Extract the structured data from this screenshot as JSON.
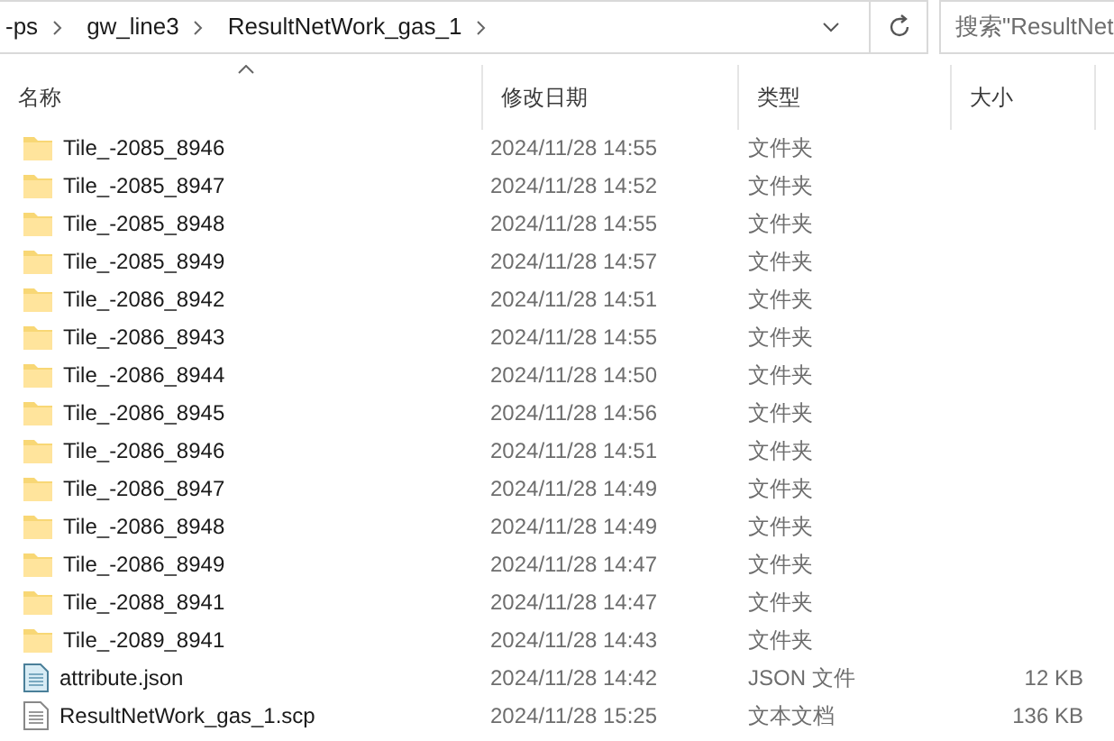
{
  "address_bar": {
    "breadcrumbs": [
      "-ps",
      "gw_line3",
      "ResultNetWork_gas_1"
    ]
  },
  "search": {
    "placeholder": "搜索\"ResultNet"
  },
  "table": {
    "columns": [
      "名称",
      "修改日期",
      "类型",
      "大小"
    ],
    "rows": [
      {
        "kind": "folder",
        "name": "Tile_-2085_8946",
        "date": "2024/11/28 14:55",
        "type": "文件夹"
      },
      {
        "kind": "folder",
        "name": "Tile_-2085_8947",
        "date": "2024/11/28 14:52",
        "type": "文件夹"
      },
      {
        "kind": "folder",
        "name": "Tile_-2085_8948",
        "date": "2024/11/28 14:55",
        "type": "文件夹"
      },
      {
        "kind": "folder",
        "name": "Tile_-2085_8949",
        "date": "2024/11/28 14:57",
        "type": "文件夹"
      },
      {
        "kind": "folder",
        "name": "Tile_-2086_8942",
        "date": "2024/11/28 14:51",
        "type": "文件夹"
      },
      {
        "kind": "folder",
        "name": "Tile_-2086_8943",
        "date": "2024/11/28 14:55",
        "type": "文件夹"
      },
      {
        "kind": "folder",
        "name": "Tile_-2086_8944",
        "date": "2024/11/28 14:50",
        "type": "文件夹"
      },
      {
        "kind": "folder",
        "name": "Tile_-2086_8945",
        "date": "2024/11/28 14:56",
        "type": "文件夹"
      },
      {
        "kind": "folder",
        "name": "Tile_-2086_8946",
        "date": "2024/11/28 14:51",
        "type": "文件夹"
      },
      {
        "kind": "folder",
        "name": "Tile_-2086_8947",
        "date": "2024/11/28 14:49",
        "type": "文件夹"
      },
      {
        "kind": "folder",
        "name": "Tile_-2086_8948",
        "date": "2024/11/28 14:49",
        "type": "文件夹"
      },
      {
        "kind": "folder",
        "name": "Tile_-2086_8949",
        "date": "2024/11/28 14:47",
        "type": "文件夹"
      },
      {
        "kind": "folder",
        "name": "Tile_-2088_8941",
        "date": "2024/11/28 14:47",
        "type": "文件夹"
      },
      {
        "kind": "folder",
        "name": "Tile_-2089_8941",
        "date": "2024/11/28 14:43",
        "type": "文件夹"
      },
      {
        "kind": "json",
        "name": "attribute.json",
        "date": "2024/11/28 14:42",
        "type": "JSON 文件",
        "size": "12 KB"
      },
      {
        "kind": "text",
        "name": "ResultNetWork_gas_1.scp",
        "date": "2024/11/28 15:25",
        "type": "文本文档",
        "size": "136 KB"
      }
    ]
  }
}
